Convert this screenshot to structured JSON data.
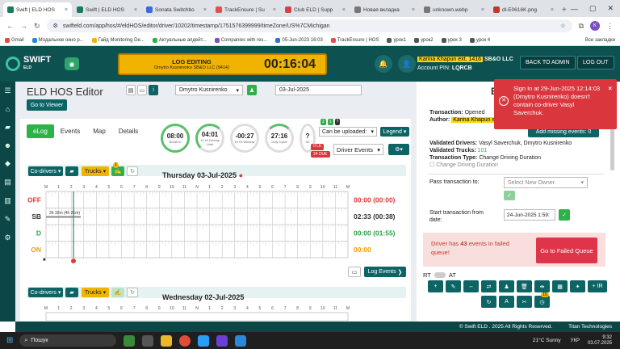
{
  "browser": {
    "tabs": [
      {
        "label": "Swift | ELD HOS",
        "color": "#1b7a5a",
        "active": true
      },
      {
        "label": "Swift | ELD HOS",
        "color": "#1b7a5a",
        "active": false
      },
      {
        "label": "Sonata Switchbo",
        "color": "#3b6cd9",
        "active": false
      },
      {
        "label": "TrackEnsure | Su",
        "color": "#e0524a",
        "active": false
      },
      {
        "label": "Club ELD | Supp",
        "color": "#d94040",
        "active": false
      },
      {
        "label": "Новая вкладка",
        "color": "#777777",
        "active": false
      },
      {
        "label": "unknown.webp",
        "color": "#777777",
        "active": false
      },
      {
        "label": "dl-E0616K.png",
        "color": "#c0392b",
        "active": false
      }
    ],
    "url": "swifteld.com/app/hos/#/eldHOS/editor/driver/10202/timestamp/1751576399999/timeZone/US%7CMichigan",
    "profile_initial": "K",
    "bookmarks": [
      "Gmail",
      "Модальное окно р...",
      "Гайд Monitoring De...",
      "Актуальные апдейт...",
      "Companies with res...",
      "05-Jun-2023 16:03",
      "TrackEnsure | HOS",
      "урок1",
      "урок2",
      "урок 3",
      "урок 4"
    ],
    "all_bookmarks": "Все закладки"
  },
  "header": {
    "logo_line1": "SWIFT",
    "logo_line2": "ELD",
    "log_editing_title": "LOG EDITING",
    "log_editing_sub": "Dmytro Kusnirenko  SB&O LLC (9414)",
    "timer": "00:16:04",
    "account_name": "Karina Khapun ext. 1416",
    "company": "SB&O LLC",
    "account_pin_label": "Account PIN:",
    "account_pin": "LQRCB",
    "back_to_admin": "BACK TO ADMIN",
    "log_out": "LOG OUT"
  },
  "editor": {
    "title": "ELD HOS Editor",
    "driver": "Dmytro Kusnirenko",
    "date": "03-Jul-2025",
    "go_to_viewer": "Go to Viewer",
    "tabs": [
      "eLog",
      "Events",
      "Map",
      "Details"
    ],
    "gauges": [
      {
        "value": "08:00",
        "label": "Break In"
      },
      {
        "value": "04:01",
        "label": "11 Hr Driving Limit"
      },
      {
        "value": "-00:27",
        "label": "14 Hr Window"
      },
      {
        "value": "27:16",
        "label": "Duty Cycle"
      },
      {
        "value": "?",
        "label": "Se"
      }
    ],
    "badges": {
      "b1": "2",
      "b2": "1",
      "b3": "?",
      "le": "0 LE",
      "due": "24 DUE"
    },
    "can_be_uploaded": "Can be uploaded:",
    "legend": "Legend",
    "driver_events": "Driver Events",
    "co_drivers": "Co-drivers",
    "trucks": "Trucks",
    "trucks_badge": "1",
    "day1_title": "Thursday 03-Jul-2025",
    "hour_labels": [
      "M",
      "1",
      "2",
      "3",
      "4",
      "5",
      "6",
      "7",
      "8",
      "9",
      "10",
      "11",
      "N",
      "1",
      "2",
      "3",
      "4",
      "5",
      "6",
      "7",
      "8",
      "9",
      "10",
      "11",
      "M"
    ],
    "statuses": [
      {
        "label": "OFF",
        "color": "#e03b3b",
        "total": "00:00 (00:00)",
        "total_color": "#e03b3b"
      },
      {
        "label": "SB",
        "color": "#333333",
        "total": "02:33 (00:38)",
        "total_color": "#333333"
      },
      {
        "label": "D",
        "color": "#2aa34a",
        "total": "00:00 (01:55)",
        "total_color": "#2aa34a"
      },
      {
        "label": "ON",
        "color": "#f0a000",
        "total": "00:00",
        "total_color": "#f0a000"
      }
    ],
    "sb_segment_label": "2h 32m (4h 21m)",
    "log_events": "Log Events",
    "day2_title": "Wednesday 02-Jul-2025"
  },
  "transaction": {
    "status_label": "Transaction:",
    "status": "Opened",
    "author_label": "Author:",
    "author": "Karina Khapun e",
    "add_missing": "Add missing events: 0",
    "validated_drivers_label": "Validated Drivers:",
    "validated_drivers": "Vasyl Saverchuk, Dmytro Kusnirenko",
    "validated_trucks_label": "Validated Trucks:",
    "validated_trucks": "101",
    "type_label": "Transaction Type:",
    "type": "Change Driving Duration",
    "type_option": "Change Driving Duration",
    "pass_label": "Pass transaction to:",
    "pass_placeholder": "Select New Owner",
    "start_label": "Start transaction from date:",
    "start_value": "24-Jun-2025 1:59:",
    "failed_text_pre": "Driver has",
    "failed_count": "43",
    "failed_text_post": "events in failed queue!",
    "go_to_failed": "Go to Failed Queue",
    "rt": "RT",
    "at": "AT",
    "ir": "+ IR",
    "tool_badge": "16"
  },
  "toast": {
    "message": "Sign In at 29-Jun-2025 12:14:03 (Dmytro Kusnirenko) doesn't contain co-driver Vasyl Saverchuk."
  },
  "footer": {
    "copyright": "© Swift ELD . 2025 All Rights Reserved.",
    "powered": "Titan Technologies"
  },
  "taskbar": {
    "search": "Пошук",
    "weather": "21°C  Sunny",
    "lang": "УКР",
    "time": "9:32",
    "date": "03.07.2025"
  },
  "colors": {
    "brand": "#0d5151",
    "accent": "#2db24a",
    "warning": "#f0b400",
    "danger": "#d9363e"
  }
}
